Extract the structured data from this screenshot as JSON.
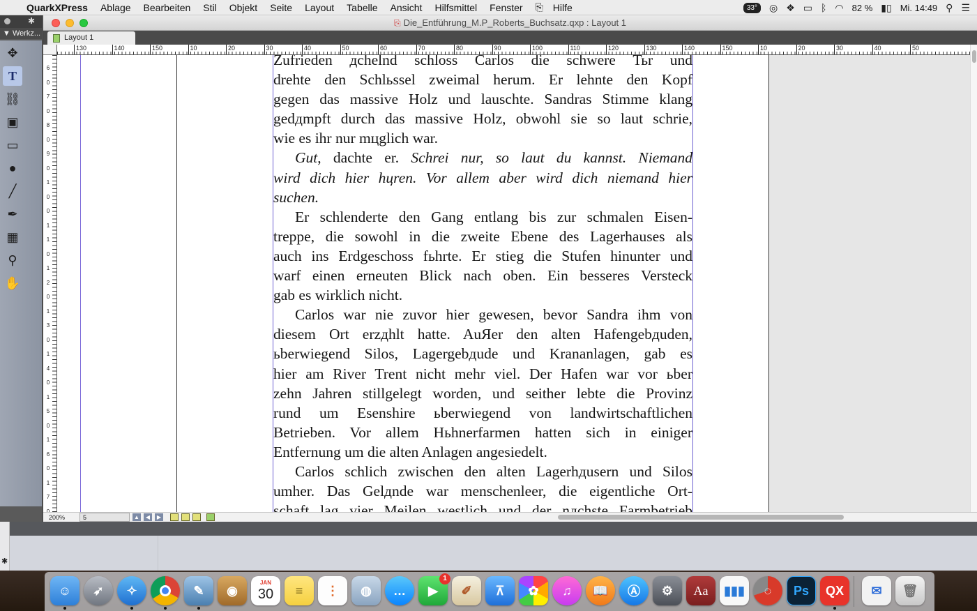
{
  "menubar": {
    "apple_glyph": "",
    "app_name": "QuarkXPress",
    "menus": [
      "Ablage",
      "Bearbeiten",
      "Stil",
      "Objekt",
      "Seite",
      "Layout",
      "Tabelle",
      "Ansicht",
      "Hilfsmittel",
      "Fenster",
      "Hilfe"
    ],
    "temperature": "33°",
    "battery": "82 %",
    "clock": "Mi. 14:49"
  },
  "window": {
    "title": "Die_Entführung_M.P_Roberts_Buchsatz.qxp : Layout 1",
    "tab_label": "Layout 1"
  },
  "tools_palette": {
    "title": "▼ Werkz..."
  },
  "ruler": {
    "h_labels": [
      "130",
      "140",
      "150",
      "10",
      "20",
      "30",
      "40",
      "50",
      "60",
      "70",
      "80",
      "90",
      "100",
      "110",
      "120",
      "130",
      "140",
      "150",
      "10",
      "20",
      "30",
      "40",
      "50"
    ],
    "v_labels": [
      "6",
      "0",
      "7",
      "0",
      "8",
      "0",
      "9",
      "0",
      "1",
      "0",
      "0",
      "1",
      "1",
      "0",
      "1",
      "2",
      "0",
      "1",
      "3",
      "0",
      "1",
      "4",
      "0",
      "1",
      "5",
      "0",
      "1",
      "6",
      "0",
      "1",
      "7",
      "0"
    ]
  },
  "document": {
    "lines": [
      {
        "text": "Zufrieden дchelnd schloss Carlos die schwere Тьr und",
        "cls": ""
      },
      {
        "text": "drehte den Schlьssel zweimal herum. Er lehnte den Kopf",
        "cls": ""
      },
      {
        "text": "gegen das massive Holz und lauschte. Sandras Stimme klang",
        "cls": ""
      },
      {
        "text": "gedдmpft durch das massive Holz, obwohl sie so laut schrie,",
        "cls": ""
      },
      {
        "text": "wie es ihr nur mцglich war.",
        "cls": "last"
      },
      {
        "text": "Gut, dachte er. Schrei nur, so laut du kannst. Niemand",
        "cls": "indent",
        "italic_runs": true
      },
      {
        "text": "wird dich hier hцren. Vor allem aber wird dich niemand hier",
        "cls": "",
        "italic": true
      },
      {
        "text": "suchen.",
        "cls": "last",
        "italic": true
      },
      {
        "text": "Er schlenderte den Gang entlang bis zur schmalen Eisen-",
        "cls": "indent"
      },
      {
        "text": "treppe, die sowohl in die zweite Ebene des Lagerhauses als",
        "cls": ""
      },
      {
        "text": "auch ins Erdgeschoss fьhrte. Er stieg die Stufen hinunter und",
        "cls": ""
      },
      {
        "text": "warf einen erneuten Blick nach oben. Ein besseres Versteck",
        "cls": ""
      },
      {
        "text": "gab es wirklich nicht.",
        "cls": "last"
      },
      {
        "text": "Carlos war nie zuvor hier gewesen, bevor Sandra ihm von",
        "cls": "indent"
      },
      {
        "text": "diesem Ort erzдhlt hatte. AuЯer den alten Hafengebдuden,",
        "cls": ""
      },
      {
        "text": "ьberwiegend Silos, Lagergebдude und Krananlagen, gab es",
        "cls": ""
      },
      {
        "text": "hier am River Trent nicht mehr viel. Der Hafen war vor ьber",
        "cls": ""
      },
      {
        "text": "zehn Jahren stillgelegt worden, und seither lebte die Provinz",
        "cls": ""
      },
      {
        "text": "rund um Esenshire ьberwiegend von landwirtschaftlichen",
        "cls": ""
      },
      {
        "text": "Betrieben. Vor allem Hьhnerfarmen hatten sich in einiger",
        "cls": ""
      },
      {
        "text": "Entfernung um die alten Anlagen angesiedelt.",
        "cls": "last"
      },
      {
        "text": "Carlos schlich zwischen den alten Lagerhдusern und Silos",
        "cls": "indent"
      },
      {
        "text": "umher. Das Gelдnde war menschenleer, die eigentliche Ort-",
        "cls": ""
      },
      {
        "text": "schaft lag vier Meilen westlich und der nдchste Farmbetrieb",
        "cls": ""
      }
    ],
    "italic_line_parts": {
      "a": "Gut",
      "b": ", dachte er. ",
      "c": "Schrei nur, so laut du kannst. Niemand"
    }
  },
  "statusbar": {
    "zoom": "200%",
    "page": "5"
  },
  "dock": {
    "calendar_month": "JAN",
    "calendar_day": "30",
    "facetime_badge": "1",
    "dictionary_label": "Aa",
    "photoshop_label": "Ps",
    "quark_label": "QX"
  },
  "colors": {
    "guide": "#7a68d8",
    "tool_selected": "#b8c8e8"
  },
  "icons": [
    "apple-icon",
    "dropbox-icon",
    "wifi-icon",
    "battery-icon",
    "spotlight-icon",
    "list-icon",
    "move-tool-icon",
    "text-tool-icon",
    "link-tool-icon",
    "picture-content-icon",
    "rect-box-icon",
    "oval-box-icon",
    "line-tool-icon",
    "pen-tool-icon",
    "table-tool-icon",
    "zoom-tool-icon",
    "hand-tool-icon"
  ]
}
